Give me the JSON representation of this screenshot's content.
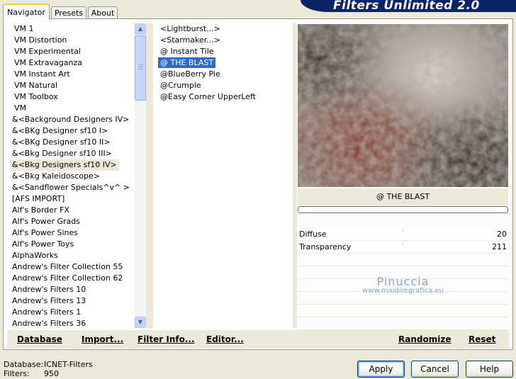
{
  "banner": {
    "title": "Filters Unlimited 2.0"
  },
  "tabs": [
    {
      "label": "Navigator",
      "active": true
    },
    {
      "label": "Presets",
      "active": false
    },
    {
      "label": "About",
      "active": false
    }
  ],
  "categories": [
    "VM 1",
    "VM Distortion",
    "VM Experimental",
    "VM Extravaganza",
    "VM Instant Art",
    "VM Natural",
    "VM Toolbox",
    "VM",
    "&<Background Designers IV>",
    "&<BKg Designer sf10 I>",
    "&<BKg Designer sf10 II>",
    "&<Bkg Designer sf10 III>",
    "&<Bkg Designers sf10 IV>",
    "&<Bkg Kaleidoscope>",
    "&<Sandflower Specials^v^ >",
    "[AFS IMPORT]",
    "Alf's Border FX",
    "Alf's Power Grads",
    "Alf's Power Sines",
    "Alf's Power Toys",
    "AlphaWorks",
    "Andrew's Filter Collection 55",
    "Andrew's Filter Collection 62",
    "Andrew's Filters 10",
    "Andrew's Filters 13",
    "Andrew's Filters 1",
    "Andrew's Filters 36"
  ],
  "selected_category_index": 12,
  "filters": [
    "<Lightburst...>",
    "<Starmaker...>",
    "@ Instant Tile",
    "@ THE BLAST",
    "@BlueBerry Pie",
    "@Crumple",
    "@Easy Corner UpperLeft"
  ],
  "selected_filter_index": 3,
  "preview": {
    "filter_name": "@ THE BLAST",
    "progress": 0
  },
  "params": [
    {
      "name": "Diffuse",
      "value": "20"
    },
    {
      "name": "Transparency",
      "value": "211"
    }
  ],
  "watermark": {
    "line1": "Pinuccia",
    "line2": "www.maidiregrafica.eu"
  },
  "toolbar": {
    "database": "Database",
    "import": "Import...",
    "filter_info": "Filter Info...",
    "editor": "Editor...",
    "randomize": "Randomize",
    "reset": "Reset"
  },
  "footer": {
    "database_label": "Database:",
    "database_value": "ICNET-Filters",
    "filters_label": "Filters:",
    "filters_value": "950"
  },
  "buttons": {
    "apply": "Apply",
    "cancel": "Cancel",
    "help": "Help"
  },
  "colors": {
    "banner": "#0a246a",
    "selection": "#316ac5",
    "window_bg": "#ece9d8"
  }
}
